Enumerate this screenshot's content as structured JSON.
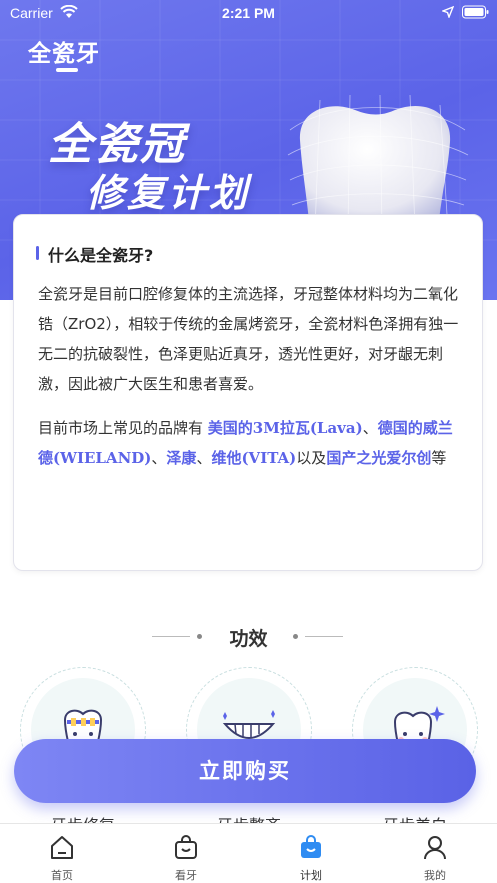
{
  "status_bar": {
    "carrier": "Carrier",
    "time": "2:21 PM"
  },
  "header": {
    "brand": "全瓷牙"
  },
  "hero": {
    "title_line1": "全瓷冠",
    "title_line2": "修复计划"
  },
  "intro_card": {
    "heading": "什么是全瓷牙?",
    "paragraph1": "全瓷牙是目前口腔修复体的主流选择，牙冠整体材料均为二氧化锆（ZrO2），相较于传统的金属烤瓷牙，全瓷材料色泽拥有独一无二的抗破裂性，色泽更贴近真牙，透光性更好，对牙龈无刺激，因此被广大医生和患者喜爱。",
    "paragraph2_prefix": "目前市场上常见的品牌有 ",
    "brand_lava": "美国的3M拉瓦(Lava)",
    "sep1": "、",
    "brand_wieland": "德国的威兰德(WIELAND)",
    "sep2": "、",
    "brand_zekang": "泽康",
    "sep3": "、",
    "brand_vita": "维他(VITA)",
    "sep4": "以及",
    "brand_domestic": "国产之光爱尔创",
    "paragraph2_suffix": "等"
  },
  "effects_section": {
    "title": "功效",
    "items": [
      {
        "label": "牙齿修复",
        "icon": "tooth-braces-icon"
      },
      {
        "label": "牙齿整齐",
        "icon": "smile-teeth-icon"
      },
      {
        "label": "牙齿美白",
        "icon": "tooth-sparkle-icon"
      }
    ]
  },
  "buy_button": {
    "label": "立即购买"
  },
  "tabbar": {
    "tabs": [
      {
        "label": "首页",
        "icon": "home-icon"
      },
      {
        "label": "看牙",
        "icon": "bag-icon"
      },
      {
        "label": "计划",
        "icon": "plan-bag-icon",
        "active": true
      },
      {
        "label": "我的",
        "icon": "user-icon"
      }
    ]
  },
  "colors": {
    "primary": "#5b63e8",
    "hero_bg": "#6f78ee",
    "accent_effect_bg": "#f1f8f8"
  }
}
